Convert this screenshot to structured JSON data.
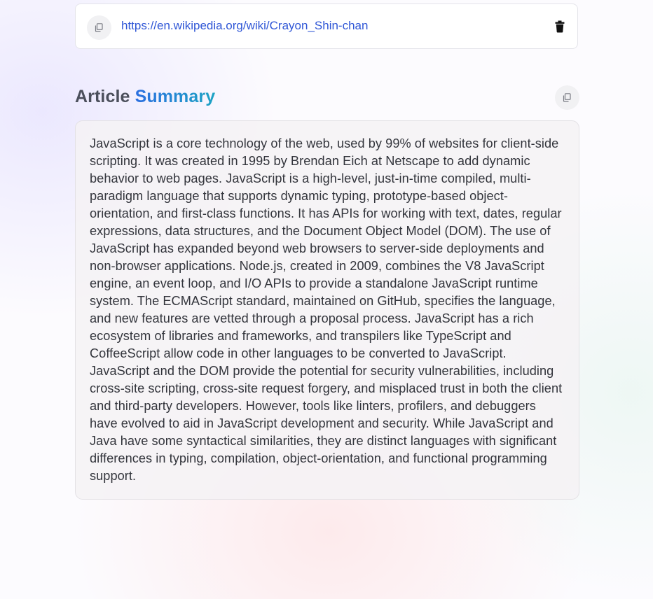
{
  "url_card": {
    "url": "https://en.wikipedia.org/wiki/Crayon_Shin-chan",
    "copy_icon": "copy-icon",
    "delete_icon": "trash-icon"
  },
  "summary": {
    "title_prefix": "Article",
    "title_accent": "Summary",
    "copy_icon": "copy-icon",
    "text": "JavaScript is a core technology of the web, used by 99% of websites for client-side scripting. It was created in 1995 by Brendan Eich at Netscape to add dynamic behavior to web pages. JavaScript is a high-level, just-in-time compiled, multi-paradigm language that supports dynamic typing, prototype-based object-orientation, and first-class functions. It has APIs for working with text, dates, regular expressions, data structures, and the Document Object Model (DOM). The use of JavaScript has expanded beyond web browsers to server-side deployments and non-browser applications. Node.js, created in 2009, combines the V8 JavaScript engine, an event loop, and I/O APIs to provide a standalone JavaScript runtime system. The ECMAScript standard, maintained on GitHub, specifies the language, and new features are vetted through a proposal process. JavaScript has a rich ecosystem of libraries and frameworks, and transpilers like TypeScript and CoffeeScript allow code in other languages to be converted to JavaScript. JavaScript and the DOM provide the potential for security vulnerabilities, including cross-site scripting, cross-site request forgery, and misplaced trust in both the client and third-party developers. However, tools like linters, profilers, and debuggers have evolved to aid in JavaScript development and security. While JavaScript and Java have some syntactical similarities, they are distinct languages with significant differences in typing, compilation, object-orientation, and functional programming support."
  },
  "colors": {
    "link": "#2f56d6",
    "accent_start": "#2b6fe0",
    "accent_end": "#1da3c4",
    "heading": "#4b4f5b",
    "body_text": "#33353c"
  }
}
